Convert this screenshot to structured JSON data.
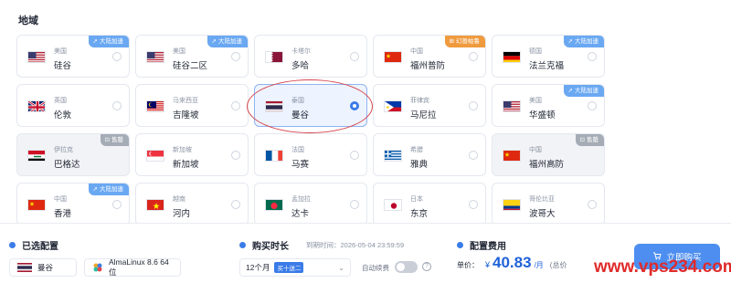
{
  "region_title": "地域",
  "regions": [
    {
      "region": "美国",
      "city": "硅谷",
      "flag": "us",
      "badge": "大陆加速",
      "badge_type": "blue",
      "state": "normal"
    },
    {
      "region": "美国",
      "city": "硅谷二区",
      "flag": "us",
      "badge": "大陆加速",
      "badge_type": "blue",
      "state": "normal"
    },
    {
      "region": "卡塔尔",
      "city": "多哈",
      "flag": "qa",
      "badge": "",
      "badge_type": "",
      "state": "normal"
    },
    {
      "region": "中国",
      "city": "福州普防",
      "flag": "cn",
      "badge": "幻兽帕鲁",
      "badge_type": "orange",
      "state": "normal"
    },
    {
      "region": "德国",
      "city": "法兰克福",
      "flag": "de",
      "badge": "大陆加速",
      "badge_type": "blue",
      "state": "normal"
    },
    {
      "region": "英国",
      "city": "伦敦",
      "flag": "gb",
      "badge": "",
      "badge_type": "",
      "state": "normal"
    },
    {
      "region": "马来西亚",
      "city": "吉隆坡",
      "flag": "my",
      "badge": "",
      "badge_type": "",
      "state": "normal"
    },
    {
      "region": "泰国",
      "city": "曼谷",
      "flag": "th",
      "badge": "",
      "badge_type": "",
      "state": "selected"
    },
    {
      "region": "菲律宾",
      "city": "马尼拉",
      "flag": "ph",
      "badge": "",
      "badge_type": "",
      "state": "normal"
    },
    {
      "region": "美国",
      "city": "华盛顿",
      "flag": "us",
      "badge": "大陆加速",
      "badge_type": "blue",
      "state": "normal"
    },
    {
      "region": "伊拉克",
      "city": "巴格达",
      "flag": "iq",
      "badge": "售罄",
      "badge_type": "grey",
      "state": "soldout"
    },
    {
      "region": "新加坡",
      "city": "新加坡",
      "flag": "sg",
      "badge": "",
      "badge_type": "",
      "state": "normal"
    },
    {
      "region": "法国",
      "city": "马赛",
      "flag": "fr",
      "badge": "",
      "badge_type": "",
      "state": "normal"
    },
    {
      "region": "希腊",
      "city": "雅典",
      "flag": "gr",
      "badge": "",
      "badge_type": "",
      "state": "normal"
    },
    {
      "region": "中国",
      "city": "福州高防",
      "flag": "cn",
      "badge": "售罄",
      "badge_type": "grey",
      "state": "soldout"
    },
    {
      "region": "中国",
      "city": "香港",
      "flag": "cn",
      "badge": "大陆加速",
      "badge_type": "blue",
      "state": "normal"
    },
    {
      "region": "越南",
      "city": "河内",
      "flag": "vn",
      "badge": "",
      "badge_type": "",
      "state": "normal"
    },
    {
      "region": "孟加拉",
      "city": "达卡",
      "flag": "bd",
      "badge": "",
      "badge_type": "",
      "state": "normal"
    },
    {
      "region": "日本",
      "city": "东京",
      "flag": "jp",
      "badge": "",
      "badge_type": "",
      "state": "normal"
    },
    {
      "region": "哥伦比亚",
      "city": "波哥大",
      "flag": "co",
      "badge": "",
      "badge_type": "",
      "state": "normal"
    }
  ],
  "bottom": {
    "selected_config_title": "已选配置",
    "selected_city": "曼谷",
    "selected_os": "AlmaLinux 8.6 64位",
    "duration_title": "购买时长",
    "deadline_label": "到期时间：",
    "deadline_value": "2026-05-04 23:59:59",
    "duration_value": "12个月",
    "discount_badge": "买十送二",
    "auto_renew_label": "自动续费",
    "auto_renew_on": false,
    "cost_title": "配置费用",
    "unit_price_label": "单价：",
    "currency": "¥",
    "price": "40.83",
    "price_unit": "/月",
    "total_label": "(总价",
    "buy_label": "立即购买"
  },
  "watermark": "www.vps234.com",
  "colors": {
    "accent": "#3a7be8",
    "price": "#1f62d8",
    "badge_blue": "#6aa8f2",
    "badge_orange": "#f09a3e",
    "badge_grey": "#a6acb6",
    "annotation_red": "#d6454b"
  }
}
